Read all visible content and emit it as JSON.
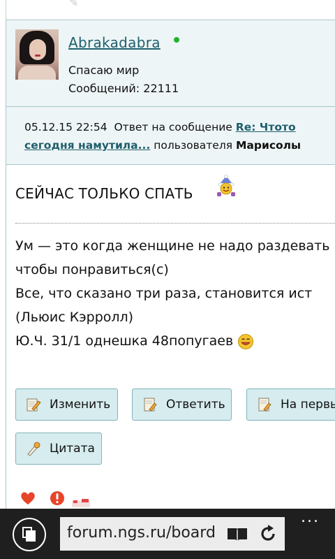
{
  "user": {
    "name": "Abrakadabra",
    "status": "Спасаю мир",
    "posts_label": "Сообщений: 22111",
    "online_color": "#22b12f"
  },
  "meta": {
    "datetime": "05.12.15 22:54",
    "reply_text": "Ответ на сообщение",
    "thread_link_part1": "Re: Чтото",
    "thread_link_part2": "сегодня намутила...",
    "by_text": "пользователя",
    "author": "Марисолы"
  },
  "post": {
    "headline": "СЕЙЧАС ТОЛЬКО СПАТЬ",
    "signature": [
      "Ум — это когда женщине не надо раздевать",
      "чтобы понравиться(с)",
      "Все, что сказано три раза, становится ист",
      "(Льюис Кэрролл)",
      "Ю.Ч. 31/1 однешка 48попугаев"
    ]
  },
  "actions": {
    "edit": "Изменить",
    "reply": "Ответить",
    "first": "На первы",
    "quote": "Цитата"
  },
  "bottom_icons": [
    "heart-icon",
    "alert-icon",
    "flag-icon"
  ],
  "browser": {
    "url": "forum.ngs.ru/board",
    "more": "..."
  },
  "colors": {
    "accent": "#1f5f6d",
    "panel": "#eef5f6",
    "button": "#d6ecef",
    "border": "#a9c7cb"
  }
}
